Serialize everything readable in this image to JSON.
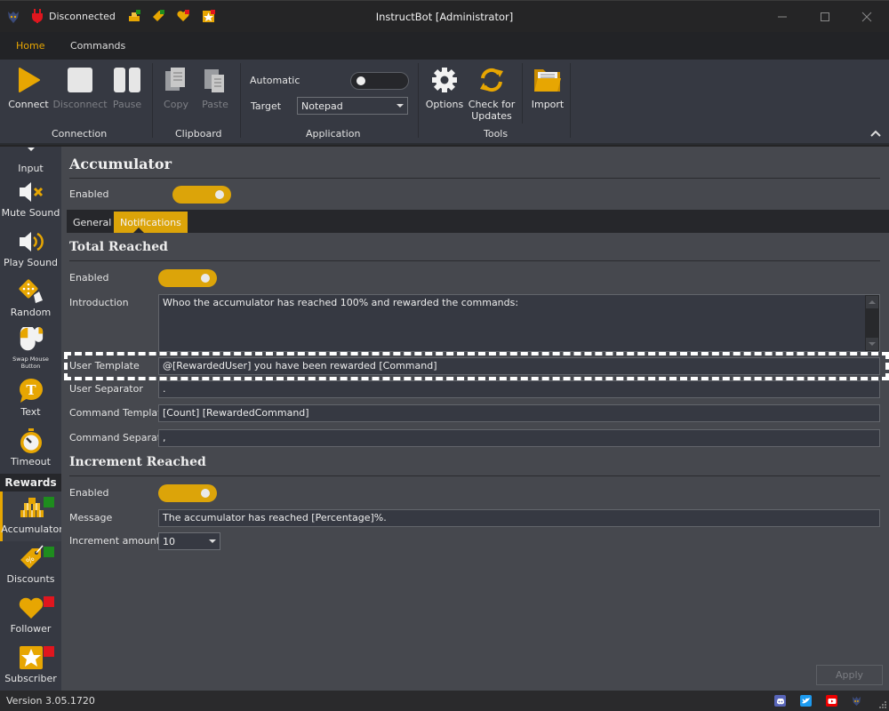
{
  "titlebar": {
    "status": "Disconnected",
    "title": "InstructBot [Administrator]",
    "quick_icons": [
      "accumulator-icon",
      "discounts-icon",
      "follower-icon",
      "subscriber-icon"
    ]
  },
  "ribbon_tabs": [
    {
      "label": "Home",
      "active": true
    },
    {
      "label": "Commands",
      "active": false
    }
  ],
  "ribbon": {
    "connection": {
      "group_label": "Connection",
      "connect": "Connect",
      "disconnect": "Disconnect",
      "pause": "Pause"
    },
    "clipboard": {
      "group_label": "Clipboard",
      "copy": "Copy",
      "paste": "Paste"
    },
    "application": {
      "group_label": "Application",
      "automatic_label": "Automatic",
      "automatic_on": false,
      "target_label": "Target",
      "target_value": "Notepad"
    },
    "tools": {
      "group_label": "Tools",
      "options": "Options",
      "check_updates_1": "Check for",
      "check_updates_2": "Updates"
    },
    "import": "Import"
  },
  "sidebar": {
    "items": [
      {
        "label": "Input",
        "icon": "input-icon"
      },
      {
        "label": "Mute Sound",
        "icon": "mute-sound-icon"
      },
      {
        "label": "Play Sound",
        "icon": "play-sound-icon"
      },
      {
        "label": "Random",
        "icon": "dice-icon"
      },
      {
        "label_1": "Swap Mouse",
        "label_2": "Button",
        "icon": "mouse-icon"
      },
      {
        "label": "Text",
        "icon": "text-bubble-icon"
      },
      {
        "label": "Timeout",
        "icon": "stopwatch-icon"
      }
    ],
    "section_header": "Rewards",
    "rewards": [
      {
        "label": "Accumulator",
        "icon": "accumulator-icon",
        "status": "enabled",
        "active": true
      },
      {
        "label": "Discounts",
        "icon": "discounts-icon",
        "status": "enabled"
      },
      {
        "label": "Follower",
        "icon": "follower-icon",
        "status": "disabled"
      },
      {
        "label": "Subscriber",
        "icon": "subscriber-icon",
        "status": "disabled"
      }
    ]
  },
  "main": {
    "title": "Accumulator",
    "enabled_label": "Enabled",
    "enabled": true,
    "tabs": [
      {
        "label": "General",
        "active": false
      },
      {
        "label": "Notifications",
        "active": true
      }
    ],
    "total_reached": {
      "heading": "Total Reached",
      "enabled_label": "Enabled",
      "enabled": true,
      "introduction_label": "Introduction",
      "introduction_value": "Whoo the accumulator has reached 100% and rewarded the commands:",
      "user_template_label": "User Template",
      "user_template_value": "@[RewardedUser]  you have been rewarded [Command]",
      "user_separator_label": "User Separator",
      "user_separator_value": ".",
      "command_template_label": "Command Template",
      "command_template_value": "[Count] [RewardedCommand]",
      "command_separator_label": "Command Separator",
      "command_separator_value": ","
    },
    "increment_reached": {
      "heading": "Increment Reached",
      "enabled_label": "Enabled",
      "enabled": true,
      "message_label": "Message",
      "message_value": "The accumulator has reached [Percentage]%.",
      "increment_label": "Increment amount",
      "increment_value": "10"
    },
    "apply": "Apply"
  },
  "statusbar": {
    "version": "Version 3.05.1720",
    "social": [
      "discord-icon",
      "twitter-icon",
      "youtube-icon",
      "instructbot-logo-icon"
    ]
  },
  "colors": {
    "accent": "#dca409",
    "enabled_badge": "#1e8c1e",
    "disabled_badge": "#e0161e",
    "disconnected": "#e0161e"
  }
}
